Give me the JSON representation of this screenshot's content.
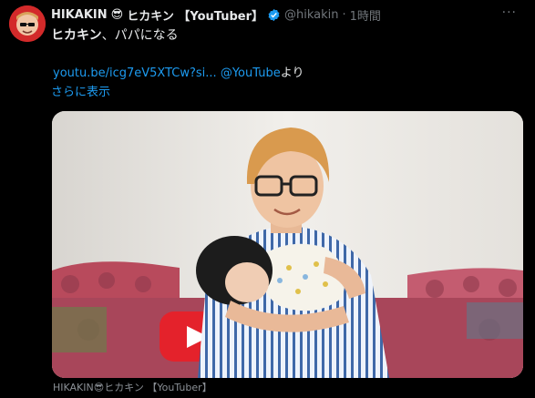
{
  "author": {
    "name": "HIKAKIN",
    "name_emoji": "😎",
    "name_suffix": "ヒカキン 【YouTuber】",
    "handle": "@hikakin",
    "separator": "·",
    "time": "1時間",
    "verified_icon": "verified-badge-icon"
  },
  "menu": {
    "more_label": "···"
  },
  "post": {
    "text_bold": "ヒカキン",
    "text_rest": "、パパになる",
    "link_text": "youtu.be/icg7eV5XTCw?si...",
    "mention_text": "@YouTube",
    "link_suffix": "より",
    "show_more": "さらに表示"
  },
  "media": {
    "caption_name": "HIKAKIN",
    "caption_emoji": "😎",
    "caption_suffix": "ヒカキン 【YouTuber】"
  },
  "colors": {
    "accent": "#1d9bf0",
    "muted": "#71767b",
    "background": "#000000"
  }
}
